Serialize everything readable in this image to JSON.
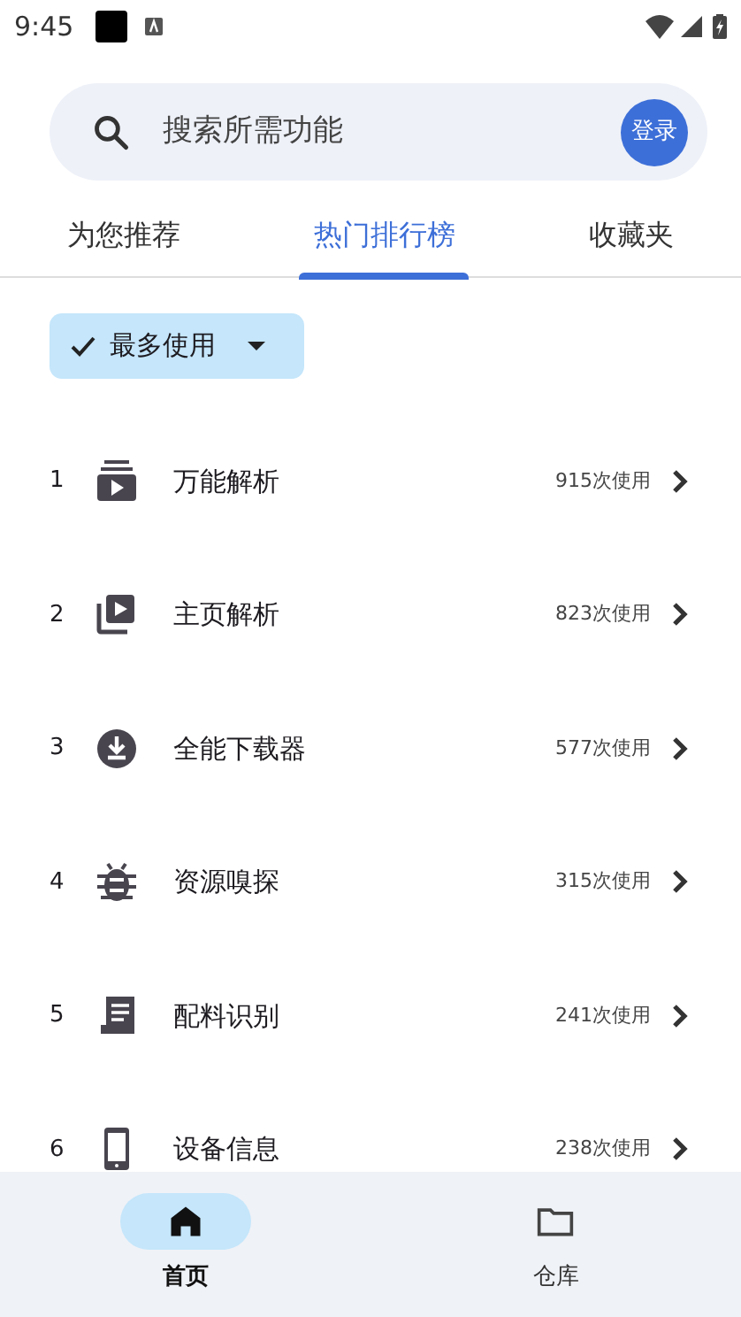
{
  "status_bar": {
    "time": "9:45"
  },
  "search": {
    "placeholder": "搜索所需功能",
    "login": "登录"
  },
  "tabs": [
    {
      "label": "为您推荐",
      "selected": false
    },
    {
      "label": "热门排行榜",
      "selected": true
    },
    {
      "label": "收藏夹",
      "selected": false
    }
  ],
  "filter_chip": {
    "label": "最多使用",
    "selected": true
  },
  "ranking": [
    {
      "rank": "1",
      "name": "万能解析",
      "uses": "915次使用"
    },
    {
      "rank": "2",
      "name": "主页解析",
      "uses": "823次使用"
    },
    {
      "rank": "3",
      "name": "全能下载器",
      "uses": "577次使用"
    },
    {
      "rank": "4",
      "name": "资源嗅探",
      "uses": "315次使用"
    },
    {
      "rank": "5",
      "name": "配料识别",
      "uses": "241次使用"
    },
    {
      "rank": "6",
      "name": "设备信息",
      "uses": "238次使用"
    }
  ],
  "bottom_nav": [
    {
      "label": "首页",
      "selected": true
    },
    {
      "label": "仓库",
      "selected": false
    }
  ]
}
